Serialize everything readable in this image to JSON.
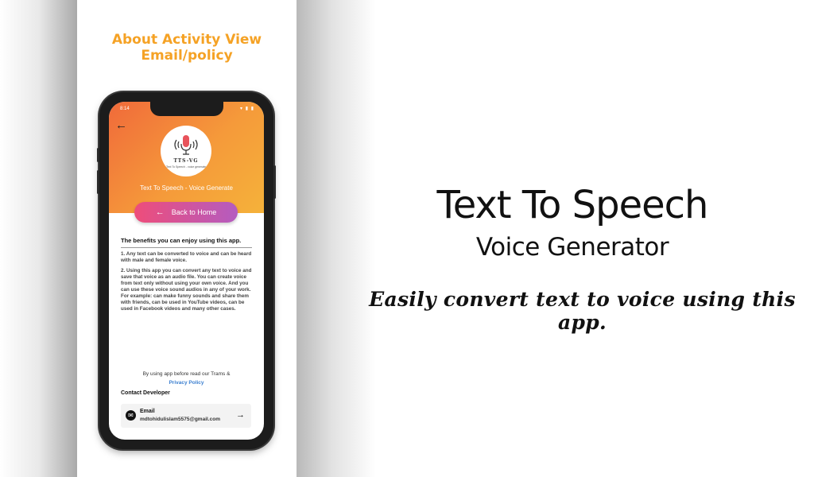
{
  "promo": {
    "title_line1": "About Activity View",
    "title_line2": "Email/policy"
  },
  "phone": {
    "status_time": "8:14",
    "status_icons": "▾ ▮ ▮",
    "back_icon": "arrow-left-icon",
    "logo": {
      "name": "TTS-VG",
      "sub": "Text To Speech - voice generate"
    },
    "app_subtitle": "Text To Speech - Voice Generate",
    "back_home_label": "Back to Home",
    "benefits_title": "The benefits you can enjoy using this app.",
    "benefits": [
      "1. Any text can be converted to voice and can be heard with male and female voice.",
      "2. Using this app you can convert any text to voice and save that voice as an audio file. You can create voice from text only without using your own voice.   And you can use these voice sound audios in any of your work.   For example: can make funny sounds and share them with friends, can be used in YouTube videos, can be used in Facebook videos and many other cases."
    ],
    "policy_text": "By using app before read our Trams &",
    "policy_link": "Privacy Policy",
    "contact_title": "Contact Developer",
    "email_label": "Email",
    "email_value": "mdtohidulislam5575@gmail.com"
  },
  "hero": {
    "title": "Text To Speech",
    "subtitle": "Voice Generator",
    "tagline": "Easily convert text to voice using this app."
  },
  "colors": {
    "promo_orange": "#f5a225",
    "gradient_start": "#f06a3a",
    "gradient_end": "#f5b23a",
    "button_start": "#ee4d7a",
    "button_end": "#b45cc0",
    "link": "#3b7fd0"
  }
}
